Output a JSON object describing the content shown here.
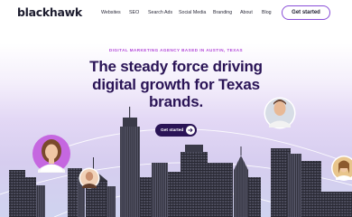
{
  "brand": {
    "logo_text": "blackhawk"
  },
  "nav": {
    "items": [
      {
        "label": "Websites"
      },
      {
        "label": "SEO"
      },
      {
        "label": "Search Ads"
      },
      {
        "label": "Social Media"
      },
      {
        "label": "Branding"
      },
      {
        "label": "About"
      },
      {
        "label": "Blog"
      }
    ],
    "cta_label": "Get started"
  },
  "hero": {
    "eyebrow": "DIGITAL MARKETING AGENCY BASED IN AUSTIN, TEXAS",
    "headline_line1": "The steady force driving",
    "headline_line2": "digital growth for Texas",
    "headline_line3": "brands.",
    "cta_label": "Get started"
  },
  "colors": {
    "brand_purple": "#2a1456",
    "accent_purple": "#8a4fd8",
    "eyebrow_pink": "#b347d9",
    "building": "#2e2e3a"
  },
  "icons": {
    "cta_arrow": "arrow-right-icon"
  }
}
